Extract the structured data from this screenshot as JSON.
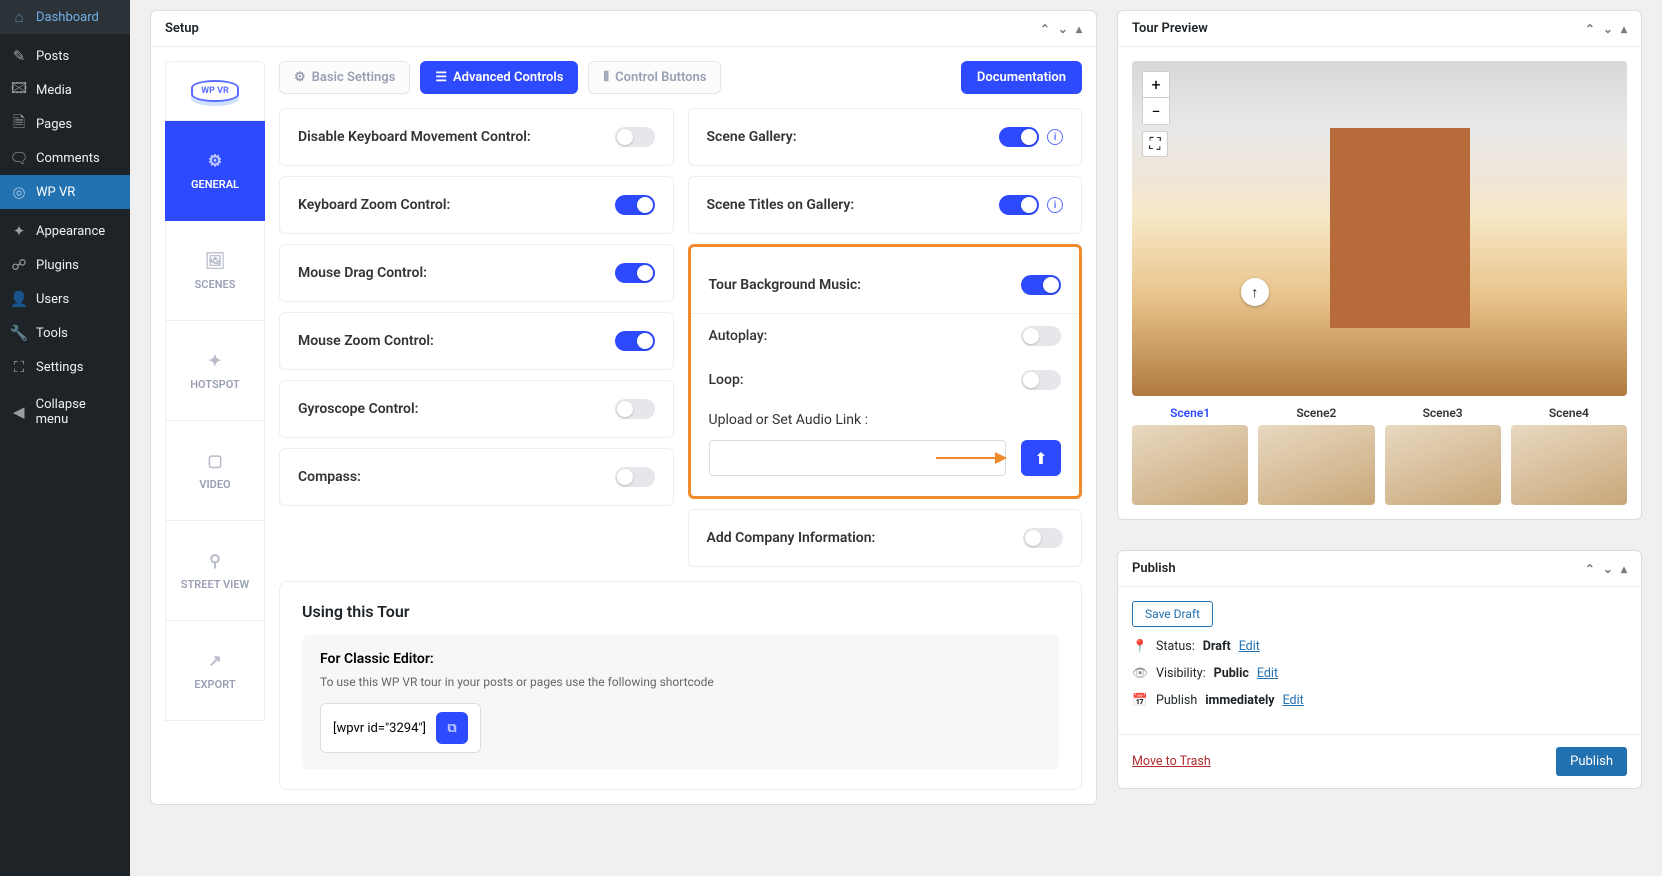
{
  "sidebar": {
    "items": [
      {
        "icon": "🏠",
        "label": "Dashboard"
      },
      {
        "icon": "📌",
        "label": "Posts"
      },
      {
        "icon": "🖼",
        "label": "Media"
      },
      {
        "icon": "📄",
        "label": "Pages"
      },
      {
        "icon": "💬",
        "label": "Comments"
      },
      {
        "icon": "🕶",
        "label": "WP VR",
        "active": true
      },
      {
        "icon": "🎨",
        "label": "Appearance"
      },
      {
        "icon": "🔌",
        "label": "Plugins"
      },
      {
        "icon": "👤",
        "label": "Users"
      },
      {
        "icon": "🔧",
        "label": "Tools"
      },
      {
        "icon": "⚙",
        "label": "Settings"
      },
      {
        "icon": "◀",
        "label": "Collapse menu"
      }
    ]
  },
  "setup": {
    "title": "Setup",
    "logo_text": "WP VR",
    "side_tabs": [
      {
        "icon": "⚙",
        "label": "GENERAL",
        "active": true
      },
      {
        "icon": "🖼",
        "label": "SCENES"
      },
      {
        "icon": "✦",
        "label": "HOTSPOT"
      },
      {
        "icon": "📹",
        "label": "VIDEO"
      },
      {
        "icon": "⚲",
        "label": "STREET VIEW"
      },
      {
        "icon": "↗",
        "label": "EXPORT"
      }
    ],
    "top_tabs": {
      "basic": "Basic Settings",
      "advanced": "Advanced Controls",
      "control": "Control Buttons"
    },
    "doc_btn": "Documentation",
    "left_settings": [
      {
        "label": "Disable Keyboard Movement Control:",
        "on": false
      },
      {
        "label": "Keyboard Zoom Control:",
        "on": true
      },
      {
        "label": "Mouse Drag Control:",
        "on": true
      },
      {
        "label": "Mouse Zoom Control:",
        "on": true
      },
      {
        "label": "Gyroscope Control:",
        "on": false
      },
      {
        "label": "Compass:",
        "on": false
      }
    ],
    "right_settings": {
      "scene_gallery": {
        "label": "Scene Gallery:",
        "on": true,
        "info": true
      },
      "scene_titles": {
        "label": "Scene Titles on Gallery:",
        "on": true,
        "info": true
      },
      "bg_music": {
        "label": "Tour Background Music:",
        "on": true
      },
      "autoplay": {
        "label": "Autoplay:",
        "on": false
      },
      "loop": {
        "label": "Loop:",
        "on": false
      },
      "upload_label": "Upload or Set Audio Link :",
      "company": {
        "label": "Add Company Information:",
        "on": false
      }
    },
    "using": {
      "title": "Using this Tour",
      "subtitle": "For Classic Editor:",
      "desc": "To use this WP VR tour in your posts or pages use the following shortcode",
      "shortcode": "[wpvr id=\"3294\"]"
    }
  },
  "preview": {
    "title": "Tour Preview",
    "scenes": [
      "Scene1",
      "Scene2",
      "Scene3",
      "Scene4"
    ]
  },
  "publish": {
    "title": "Publish",
    "save_draft": "Save Draft",
    "status_label": "Status:",
    "status_value": "Draft",
    "visibility_label": "Visibility:",
    "visibility_value": "Public",
    "publish_label": "Publish",
    "publish_value": "immediately",
    "edit": "Edit",
    "trash": "Move to Trash",
    "publish_btn": "Publish"
  }
}
